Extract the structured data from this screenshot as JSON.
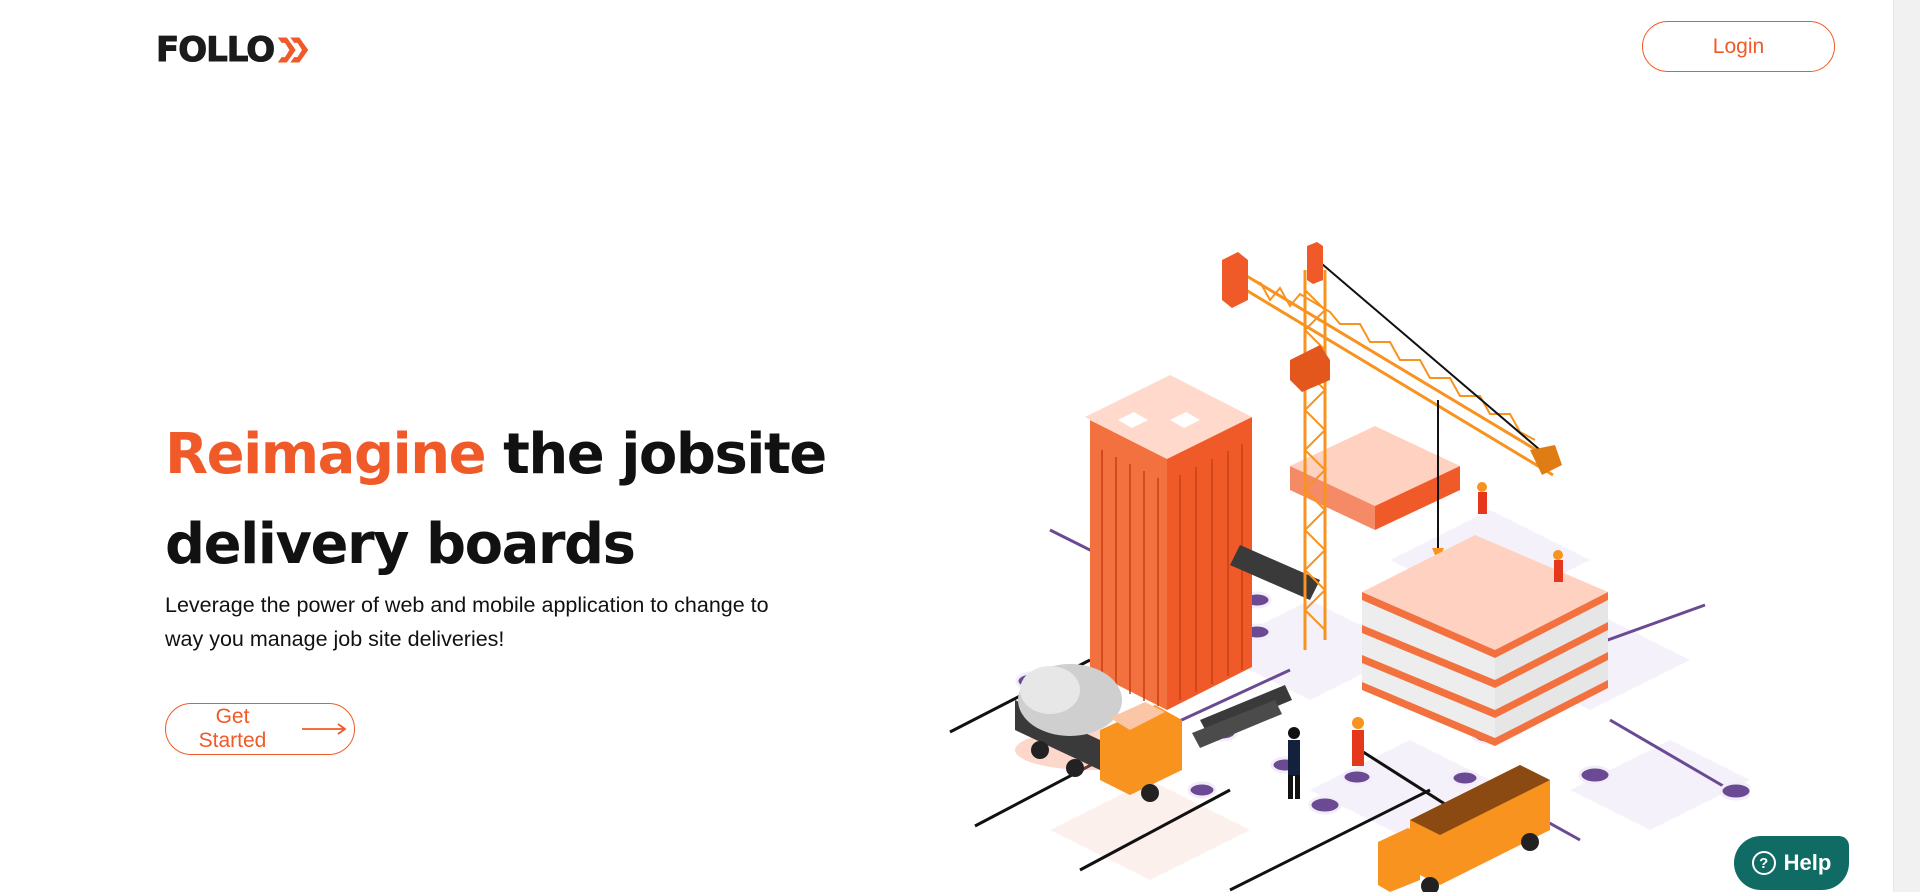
{
  "header": {
    "logo_text": "FOLLO",
    "login_label": "Login"
  },
  "hero": {
    "title_accent": "Reimagine",
    "title_rest": " the jobsite delivery boards",
    "subtitle": "Leverage the power of web and mobile application to change to way you manage job site deliveries!",
    "cta_label": "Get Started"
  },
  "help": {
    "label": "Help",
    "icon_glyph": "?"
  },
  "colors": {
    "accent": "#f05a28",
    "help_bg": "#0f6b63"
  }
}
